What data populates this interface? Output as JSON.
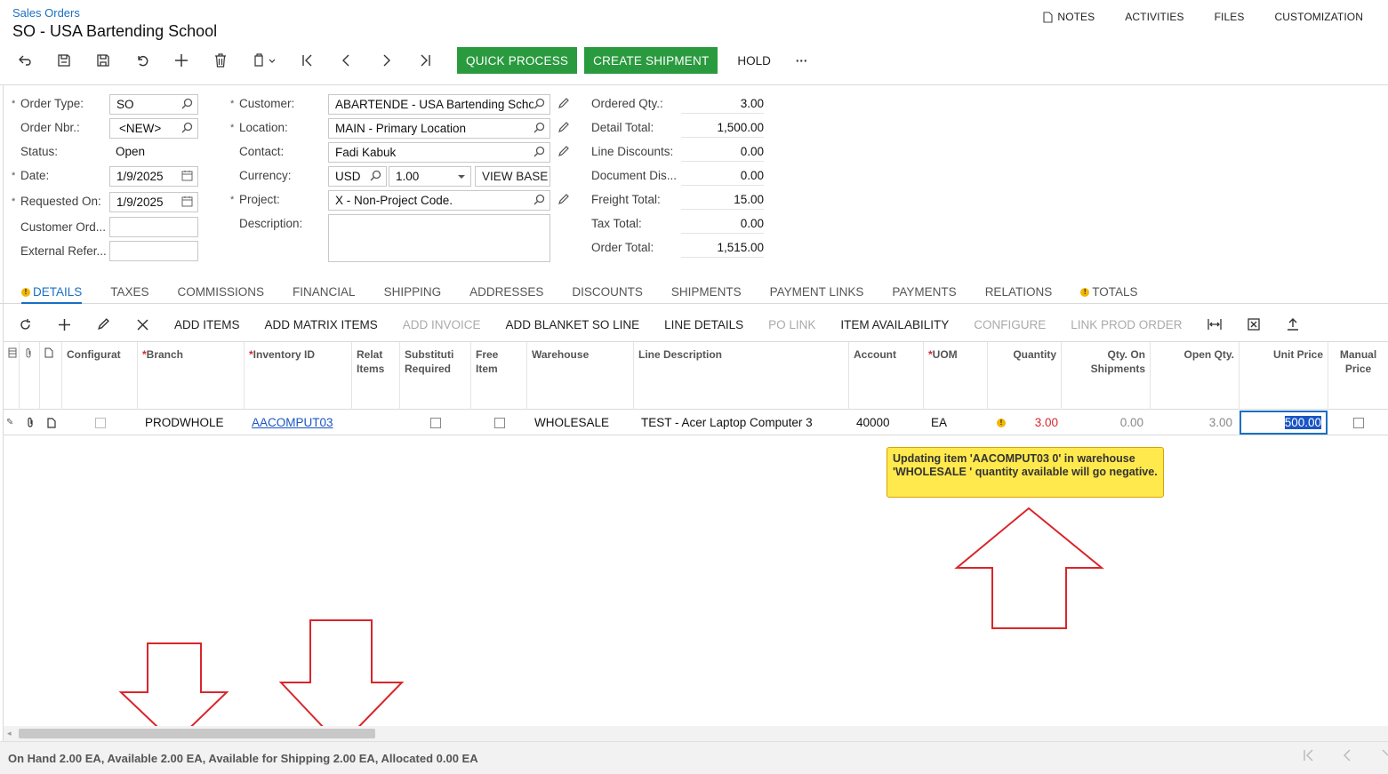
{
  "breadcrumb": "Sales Orders",
  "title": "SO - USA Bartending School",
  "top_links": {
    "notes": "NOTES",
    "activities": "ACTIVITIES",
    "files": "FILES",
    "customization": "CUSTOMIZATION"
  },
  "toolbar": {
    "quick_process": "QUICK PROCESS",
    "create_shipment": "CREATE SHIPMENT",
    "hold": "HOLD",
    "more": "···"
  },
  "form": {
    "order_type_label": "Order Type:",
    "order_type": "SO",
    "order_nbr_label": "Order Nbr.:",
    "order_nbr": "<NEW>",
    "status_label": "Status:",
    "status": "Open",
    "date_label": "Date:",
    "date": "1/9/2025",
    "requested_on_label": "Requested On:",
    "requested_on": "1/9/2025",
    "customer_ord_label": "Customer Ord...",
    "customer_ord": "",
    "external_refer_label": "External Refer...",
    "external_refer": "",
    "customer_label": "Customer:",
    "customer": "ABARTENDE - USA Bartending School",
    "location_label": "Location:",
    "location": "MAIN - Primary Location",
    "contact_label": "Contact:",
    "contact": "Fadi Kabuk",
    "currency_label": "Currency:",
    "currency": "USD",
    "rate": "1.00",
    "view_base": "VIEW BASE",
    "project_label": "Project:",
    "project": "X - Non-Project Code.",
    "description_label": "Description:",
    "description": ""
  },
  "summary": [
    {
      "label": "Ordered Qty.:",
      "value": "3.00"
    },
    {
      "label": "Detail Total:",
      "value": "1,500.00"
    },
    {
      "label": "Line Discounts:",
      "value": "0.00"
    },
    {
      "label": "Document Dis...",
      "value": "0.00"
    },
    {
      "label": "Freight Total:",
      "value": "15.00"
    },
    {
      "label": "Tax Total:",
      "value": "0.00"
    },
    {
      "label": "Order Total:",
      "value": "1,515.00"
    }
  ],
  "tabs": [
    "DETAILS",
    "TAXES",
    "COMMISSIONS",
    "FINANCIAL",
    "SHIPPING",
    "ADDRESSES",
    "DISCOUNTS",
    "SHIPMENTS",
    "PAYMENT LINKS",
    "PAYMENTS",
    "RELATIONS",
    "TOTALS"
  ],
  "grid_toolbar": {
    "add_items": "ADD ITEMS",
    "add_matrix_items": "ADD MATRIX ITEMS",
    "add_invoice": "ADD INVOICE",
    "add_blanket": "ADD BLANKET SO LINE",
    "line_details": "LINE DETAILS",
    "po_link": "PO LINK",
    "item_availability": "ITEM AVAILABILITY",
    "configure": "CONFIGURE",
    "link_prod_order": "LINK PROD ORDER"
  },
  "columns": {
    "configurat": "Configurat",
    "branch": "Branch",
    "inventory_id": "Inventory ID",
    "relat_items": "Relat Items",
    "substituti_required": "Substituti Required",
    "free_item": "Free Item",
    "warehouse": "Warehouse",
    "line_description": "Line Description",
    "account": "Account",
    "uom": "UOM",
    "quantity": "Quantity",
    "qty_on_shipments": "Qty. On Shipments",
    "open_qty": "Open Qty.",
    "unit_price": "Unit Price",
    "manual_price": "Manual Price"
  },
  "row": {
    "branch": "PRODWHOLE",
    "inventory_id": "AACOMPUT03",
    "warehouse": "WHOLESALE",
    "line_description": "TEST - Acer Laptop Computer 3",
    "account": "40000",
    "uom": "EA",
    "quantity": "3.00",
    "qty_on_shipments": "0.00",
    "open_qty": "3.00",
    "unit_price": "500.00"
  },
  "tooltip": "Updating item 'AACOMPUT03 0' in warehouse 'WHOLESALE ' quantity available will go negative.",
  "status_bar": "On Hand 2.00 EA, Available 2.00 EA, Available for Shipping 2.00 EA, Allocated 0.00 EA",
  "colors": {
    "accent": "#1a6fc4",
    "green": "#2a9a3f",
    "warning": "#f2b705",
    "tooltip_bg": "#ffe94d",
    "annotation_red": "#d9262b"
  }
}
